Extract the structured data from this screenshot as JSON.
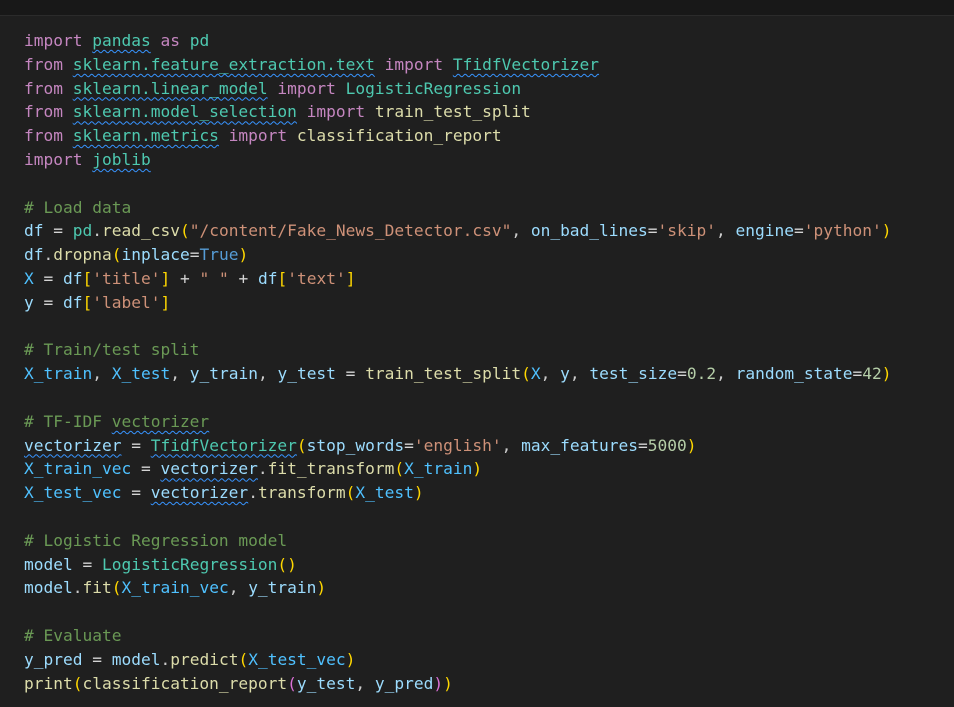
{
  "editor": {
    "language": "python",
    "theme_colors": {
      "background": "#1f1f1f",
      "keyword": "#c586c0",
      "module": "#4ec9b0",
      "function": "#dcdcaa",
      "variable": "#9cdcfe",
      "string": "#ce9178",
      "number": "#b5cea8",
      "comment": "#6a9955",
      "bracket1": "#ffd700",
      "bracket2": "#da70d6",
      "bracket3": "#179fff",
      "squiggle": "#3794ff"
    },
    "lines": [
      [
        {
          "t": "import",
          "c": "kw"
        },
        {
          "t": " "
        },
        {
          "t": "pandas",
          "c": "mod",
          "w": true
        },
        {
          "t": " "
        },
        {
          "t": "as",
          "c": "kw"
        },
        {
          "t": " "
        },
        {
          "t": "pd",
          "c": "mod"
        }
      ],
      [
        {
          "t": "from",
          "c": "kw"
        },
        {
          "t": " "
        },
        {
          "t": "sklearn.feature_extraction.text",
          "c": "mod",
          "w": true
        },
        {
          "t": " "
        },
        {
          "t": "import",
          "c": "kw"
        },
        {
          "t": " "
        },
        {
          "t": "TfidfVectorizer",
          "c": "cls",
          "w": true
        }
      ],
      [
        {
          "t": "from",
          "c": "kw"
        },
        {
          "t": " "
        },
        {
          "t": "sklearn.linear_model",
          "c": "mod",
          "w": true
        },
        {
          "t": " "
        },
        {
          "t": "import",
          "c": "kw"
        },
        {
          "t": " "
        },
        {
          "t": "LogisticRegression",
          "c": "cls"
        }
      ],
      [
        {
          "t": "from",
          "c": "kw"
        },
        {
          "t": " "
        },
        {
          "t": "sklearn.model_selection",
          "c": "mod",
          "w": true
        },
        {
          "t": " "
        },
        {
          "t": "import",
          "c": "kw"
        },
        {
          "t": " "
        },
        {
          "t": "train_test_split",
          "c": "fn"
        }
      ],
      [
        {
          "t": "from",
          "c": "kw"
        },
        {
          "t": " "
        },
        {
          "t": "sklearn.metrics",
          "c": "mod",
          "w": true
        },
        {
          "t": " "
        },
        {
          "t": "import",
          "c": "kw"
        },
        {
          "t": " "
        },
        {
          "t": "classification_report",
          "c": "fn"
        }
      ],
      [
        {
          "t": "import",
          "c": "kw"
        },
        {
          "t": " "
        },
        {
          "t": "joblib",
          "c": "mod",
          "w": true
        }
      ],
      [],
      [
        {
          "t": "# Load data",
          "c": "cmt"
        }
      ],
      [
        {
          "t": "df",
          "c": "var"
        },
        {
          "t": " = ",
          "c": "op"
        },
        {
          "t": "pd",
          "c": "mod"
        },
        {
          "t": "."
        },
        {
          "t": "read_csv",
          "c": "fn"
        },
        {
          "t": "(",
          "c": "p1"
        },
        {
          "t": "\"/content/Fake_News_Detector.csv\"",
          "c": "str"
        },
        {
          "t": ", "
        },
        {
          "t": "on_bad_lines",
          "c": "var"
        },
        {
          "t": "=",
          "c": "op"
        },
        {
          "t": "'skip'",
          "c": "str"
        },
        {
          "t": ", "
        },
        {
          "t": "engine",
          "c": "var"
        },
        {
          "t": "=",
          "c": "op"
        },
        {
          "t": "'python'",
          "c": "str"
        },
        {
          "t": ")",
          "c": "p1"
        }
      ],
      [
        {
          "t": "df",
          "c": "var"
        },
        {
          "t": "."
        },
        {
          "t": "dropna",
          "c": "fn"
        },
        {
          "t": "(",
          "c": "p1"
        },
        {
          "t": "inplace",
          "c": "var"
        },
        {
          "t": "=",
          "c": "op"
        },
        {
          "t": "True",
          "c": "bool"
        },
        {
          "t": ")",
          "c": "p1"
        }
      ],
      [
        {
          "t": "X",
          "c": "const"
        },
        {
          "t": " = ",
          "c": "op"
        },
        {
          "t": "df",
          "c": "var"
        },
        {
          "t": "[",
          "c": "p1"
        },
        {
          "t": "'title'",
          "c": "str"
        },
        {
          "t": "]",
          "c": "p1"
        },
        {
          "t": " + ",
          "c": "op"
        },
        {
          "t": "\" \"",
          "c": "str"
        },
        {
          "t": " + ",
          "c": "op"
        },
        {
          "t": "df",
          "c": "var"
        },
        {
          "t": "[",
          "c": "p1"
        },
        {
          "t": "'text'",
          "c": "str"
        },
        {
          "t": "]",
          "c": "p1"
        }
      ],
      [
        {
          "t": "y",
          "c": "var"
        },
        {
          "t": " = ",
          "c": "op"
        },
        {
          "t": "df",
          "c": "var"
        },
        {
          "t": "[",
          "c": "p1"
        },
        {
          "t": "'label'",
          "c": "str"
        },
        {
          "t": "]",
          "c": "p1"
        }
      ],
      [],
      [
        {
          "t": "# Train/test split",
          "c": "cmt"
        }
      ],
      [
        {
          "t": "X_train",
          "c": "const"
        },
        {
          "t": ", "
        },
        {
          "t": "X_test",
          "c": "const"
        },
        {
          "t": ", "
        },
        {
          "t": "y_train",
          "c": "var"
        },
        {
          "t": ", "
        },
        {
          "t": "y_test",
          "c": "var"
        },
        {
          "t": " = ",
          "c": "op"
        },
        {
          "t": "train_test_split",
          "c": "fn"
        },
        {
          "t": "(",
          "c": "p1"
        },
        {
          "t": "X",
          "c": "const"
        },
        {
          "t": ", "
        },
        {
          "t": "y",
          "c": "var"
        },
        {
          "t": ", "
        },
        {
          "t": "test_size",
          "c": "var"
        },
        {
          "t": "=",
          "c": "op"
        },
        {
          "t": "0.2",
          "c": "num"
        },
        {
          "t": ", "
        },
        {
          "t": "random_state",
          "c": "var"
        },
        {
          "t": "=",
          "c": "op"
        },
        {
          "t": "42",
          "c": "num"
        },
        {
          "t": ")",
          "c": "p1"
        }
      ],
      [],
      [
        {
          "t": "# TF-IDF ",
          "c": "cmt"
        },
        {
          "t": "vectorizer",
          "c": "cmt",
          "w": true
        }
      ],
      [
        {
          "t": "vectorizer",
          "c": "var",
          "w": true
        },
        {
          "t": " = ",
          "c": "op"
        },
        {
          "t": "TfidfVectorizer",
          "c": "cls",
          "w": true
        },
        {
          "t": "(",
          "c": "p1"
        },
        {
          "t": "stop_words",
          "c": "var"
        },
        {
          "t": "=",
          "c": "op"
        },
        {
          "t": "'english'",
          "c": "str"
        },
        {
          "t": ", "
        },
        {
          "t": "max_features",
          "c": "var"
        },
        {
          "t": "=",
          "c": "op"
        },
        {
          "t": "5000",
          "c": "num"
        },
        {
          "t": ")",
          "c": "p1"
        }
      ],
      [
        {
          "t": "X_train_vec",
          "c": "const"
        },
        {
          "t": " = ",
          "c": "op"
        },
        {
          "t": "vectorizer",
          "c": "var",
          "w": true
        },
        {
          "t": "."
        },
        {
          "t": "fit_transform",
          "c": "fn"
        },
        {
          "t": "(",
          "c": "p1"
        },
        {
          "t": "X_train",
          "c": "const"
        },
        {
          "t": ")",
          "c": "p1"
        }
      ],
      [
        {
          "t": "X_test_vec",
          "c": "const"
        },
        {
          "t": " = ",
          "c": "op"
        },
        {
          "t": "vectorizer",
          "c": "var",
          "w": true
        },
        {
          "t": "."
        },
        {
          "t": "transform",
          "c": "fn"
        },
        {
          "t": "(",
          "c": "p1"
        },
        {
          "t": "X_test",
          "c": "const"
        },
        {
          "t": ")",
          "c": "p1"
        }
      ],
      [],
      [
        {
          "t": "# Logistic Regression model",
          "c": "cmt"
        }
      ],
      [
        {
          "t": "model",
          "c": "var"
        },
        {
          "t": " = ",
          "c": "op"
        },
        {
          "t": "LogisticRegression",
          "c": "cls"
        },
        {
          "t": "()",
          "c": "p1"
        }
      ],
      [
        {
          "t": "model",
          "c": "var"
        },
        {
          "t": "."
        },
        {
          "t": "fit",
          "c": "fn"
        },
        {
          "t": "(",
          "c": "p1"
        },
        {
          "t": "X_train_vec",
          "c": "const"
        },
        {
          "t": ", "
        },
        {
          "t": "y_train",
          "c": "var"
        },
        {
          "t": ")",
          "c": "p1"
        }
      ],
      [],
      [
        {
          "t": "# Evaluate",
          "c": "cmt"
        }
      ],
      [
        {
          "t": "y_pred",
          "c": "var"
        },
        {
          "t": " = ",
          "c": "op"
        },
        {
          "t": "model",
          "c": "var"
        },
        {
          "t": "."
        },
        {
          "t": "predict",
          "c": "fn"
        },
        {
          "t": "(",
          "c": "p1"
        },
        {
          "t": "X_test_vec",
          "c": "const"
        },
        {
          "t": ")",
          "c": "p1"
        }
      ],
      [
        {
          "t": "print",
          "c": "fn"
        },
        {
          "t": "(",
          "c": "p1"
        },
        {
          "t": "classification_report",
          "c": "fn"
        },
        {
          "t": "(",
          "c": "p2"
        },
        {
          "t": "y_test",
          "c": "var"
        },
        {
          "t": ", "
        },
        {
          "t": "y_pred",
          "c": "var"
        },
        {
          "t": ")",
          "c": "p2"
        },
        {
          "t": ")",
          "c": "p1"
        }
      ]
    ]
  }
}
